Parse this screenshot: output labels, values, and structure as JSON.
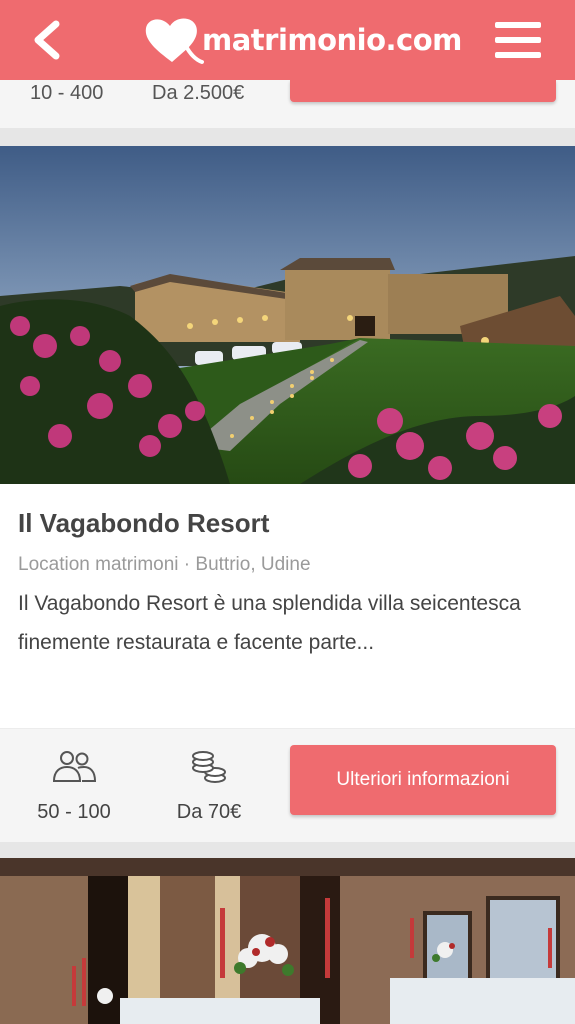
{
  "header": {
    "back_icon": "chevron-left-icon",
    "brand": "matrimonio.com",
    "menu_icon": "hamburger-menu-icon",
    "color": "#ef6b6f"
  },
  "previous_card": {
    "capacity": "10 - 400",
    "price": "Da 2.500€"
  },
  "card": {
    "photo": "evening courtyard of villa with lit tables and pink flowers",
    "title": "Il Vagabondo Resort",
    "meta": "Location matrimoni · Buttrio, Udine",
    "description": "Il Vagabondo Resort è una splendida villa seicentesca finemente restaurata e facente parte...",
    "capacity_icon": "guests-icon",
    "capacity": "50 - 100",
    "price_icon": "coins-icon",
    "price": "Da 70€",
    "cta_label": "Ulteriori informazioni"
  },
  "next_card": {
    "photo": "banquet hall with brick walls, candles and table centerpieces"
  }
}
